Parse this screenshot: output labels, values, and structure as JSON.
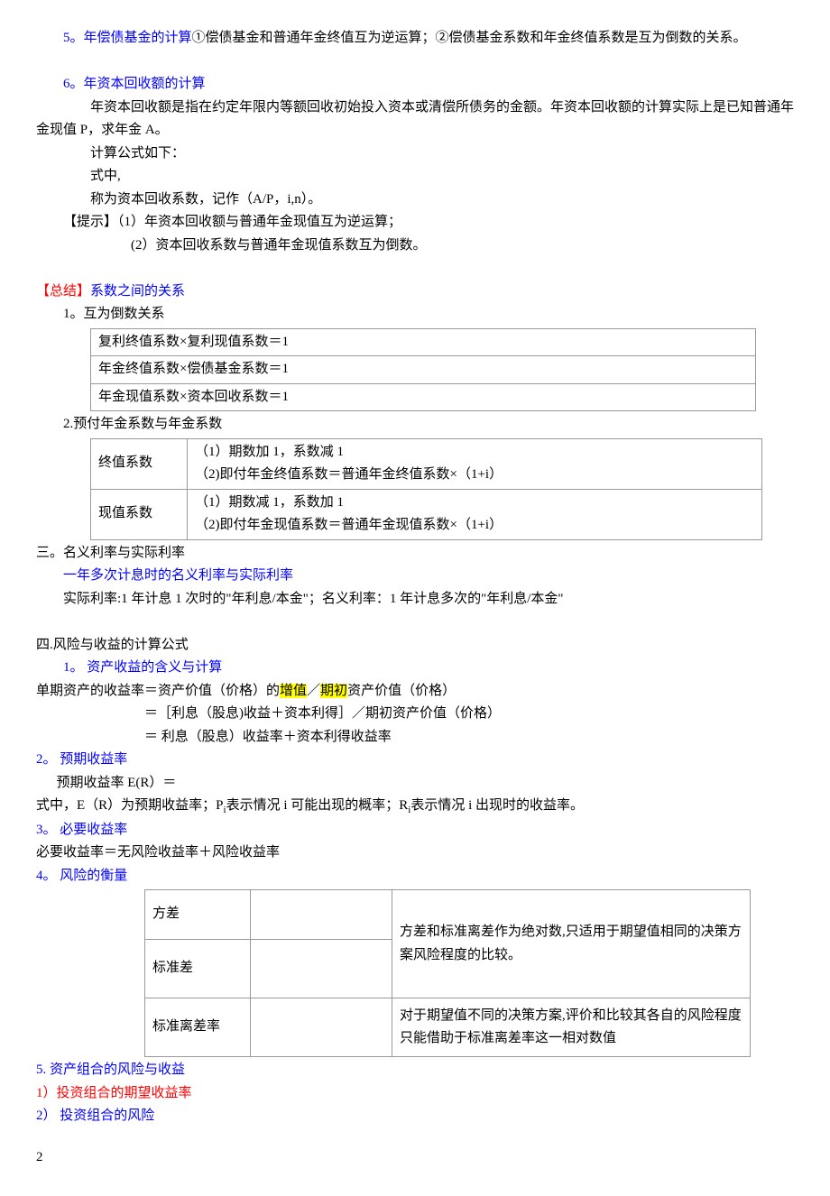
{
  "p1": "5。年偿债基金的计算",
  "p1b": "①偿债基金和普通年金终值互为逆运算；②偿债基金系数和年金终值系数是互为倒数的关系。",
  "p2": "6。年资本回收额的计算",
  "p3": "年资本回收额是指在约定年限内等额回收初始投入资本或清偿所债务的金额。年资本回收额的计算实际上是已知普通年金现值 P，求年金 A。",
  "p4": "计算公式如下：",
  "p5": "式中,",
  "p6": "称为资本回收系数，记作（A/P，i,n）。",
  "p7": "【提示】（1）年资本回收额与普通年金现值互为逆运算；",
  "p8": "(2）资本回收系数与普通年金现值系数互为倒数。",
  "s1a": "【总结】",
  "s1b": "系数之间的关系",
  "s1_1": "1。互为倒数关系",
  "t1r1": "复利终值系数×复利现值系数＝1",
  "t1r2": "年金终值系数×偿债基金系数＝1",
  "t1r3": "年金现值系数×资本回收系数＝1",
  "s1_2": "2.预付年金系数与年金系数",
  "t2r1c1": "终值系数",
  "t2r1c2a": "（1）期数加 1，系数减 1",
  "t2r1c2b": "（2)即付年金终值系数＝普通年金终值系数×（1+i）",
  "t2r2c1": "现值系数",
  "t2r2c2a": "（1）期数减 1，系数加 1",
  "t2r2c2b": "（2)即付年金现值系数＝普通年金现值系数×（1+i）",
  "s2": "三。名义利率与实际利率",
  "s2_1": "一年多次计息时的名义利率与实际利率",
  "s2_2": "实际利率:1 年计息 1 次时的\"年利息/本金\"；名义利率：1 年计息多次的\"年利息/本金\"",
  "s3": "四.风险与收益的计算公式",
  "s3_1": "1。 资产收益的含义与计算",
  "p9a": "单期资产的收益率＝资产价值（价格）的",
  "hl1": "增值",
  "p9b": "／",
  "hl2": "期初",
  "p9c": "资产价值（价格）",
  "p10": "＝［利息（股息)收益＋资本利得］／期初资产价值（价格）",
  "p11": "＝ 利息（股息）收益率＋资本利得收益率",
  "s3_2": "2。 预期收益率",
  "p12": "预期收益率 E(R）＝",
  "p13a": "式中，E（R）为预期收益率；P",
  "p13b": "表示情况 i 可能出现的概率；R",
  "p13c": "表示情况 i 出现时的收益率。",
  "sub_i": "i",
  "s3_3": "3。 必要收益率",
  "p14": "必要收益率＝无风险收益率＋风险收益率",
  "s3_4": "4。 风险的衡量",
  "t3r1c1": "方差",
  "t3r2c1": "标准差",
  "t3r12c3": "方差和标准离差作为绝对数,只适用于期望值相同的决策方案风险程度的比较。",
  "t3r3c1": "标准离差率",
  "t3r3c3": "对于期望值不同的决策方案,评价和比较其各自的风险程度只能借助于标准离差率这一相对数值",
  "s3_5": "5. 资产组合的风险与收益",
  "s3_5_1": "1）投资组合的期望收益率",
  "s3_5_2": "2） 投资组合的风险",
  "pagenum": "2"
}
